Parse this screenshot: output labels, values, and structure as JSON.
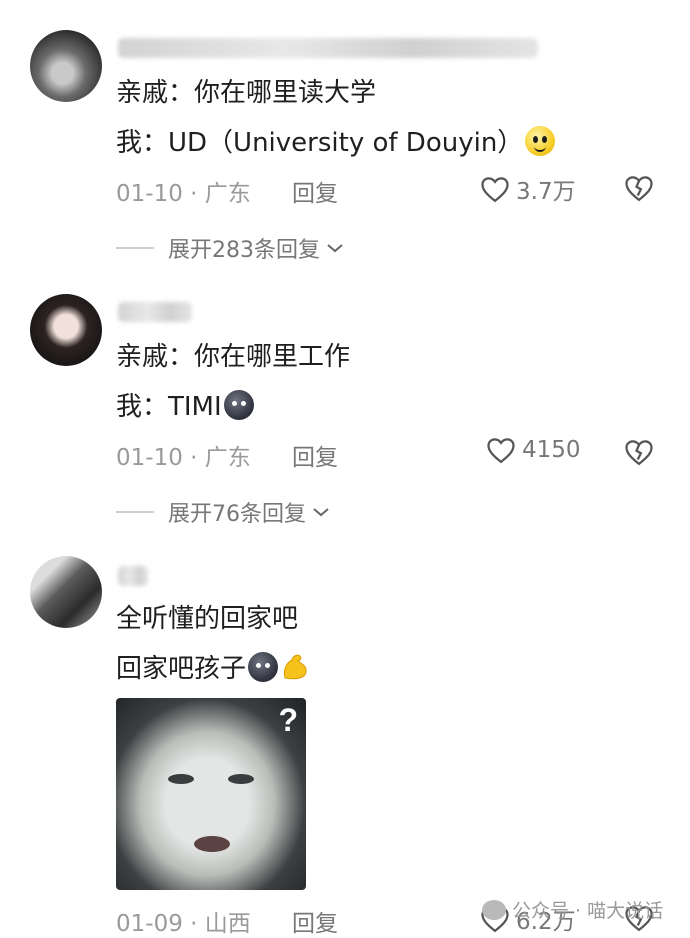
{
  "comments": [
    {
      "lines": [
        "亲戚：你在哪里读大学",
        "我：UD（University of Douyin）"
      ],
      "emoji_1": "smiling-face-emoji",
      "date_location": "01-10 · 广东",
      "reply_label": "回复",
      "likes": "3.7万",
      "expand_label": "展开283条回复"
    },
    {
      "lines": [
        "亲戚：你在哪里工作",
        "我：TIMI"
      ],
      "emoji_1": "dark-face-emoji",
      "date_location": "01-10 · 广东",
      "reply_label": "回复",
      "likes": "4150",
      "expand_label": "展开76条回复"
    },
    {
      "lines": [
        "全听懂的回家吧",
        "回家吧孩子"
      ],
      "emoji_1": "dark-face-emoji",
      "emoji_2": "flexed-arm-emoji",
      "image_overlay": "?",
      "date_location": "01-09 · 山西",
      "reply_label": "回复",
      "likes": "6.2万"
    }
  ],
  "watermark": "公众号 · 喵大说话",
  "colors": {
    "meta_text": "#9a9a9a",
    "body_text": "#1f1f1f",
    "emoji_yellow": "#f7cf2a"
  }
}
